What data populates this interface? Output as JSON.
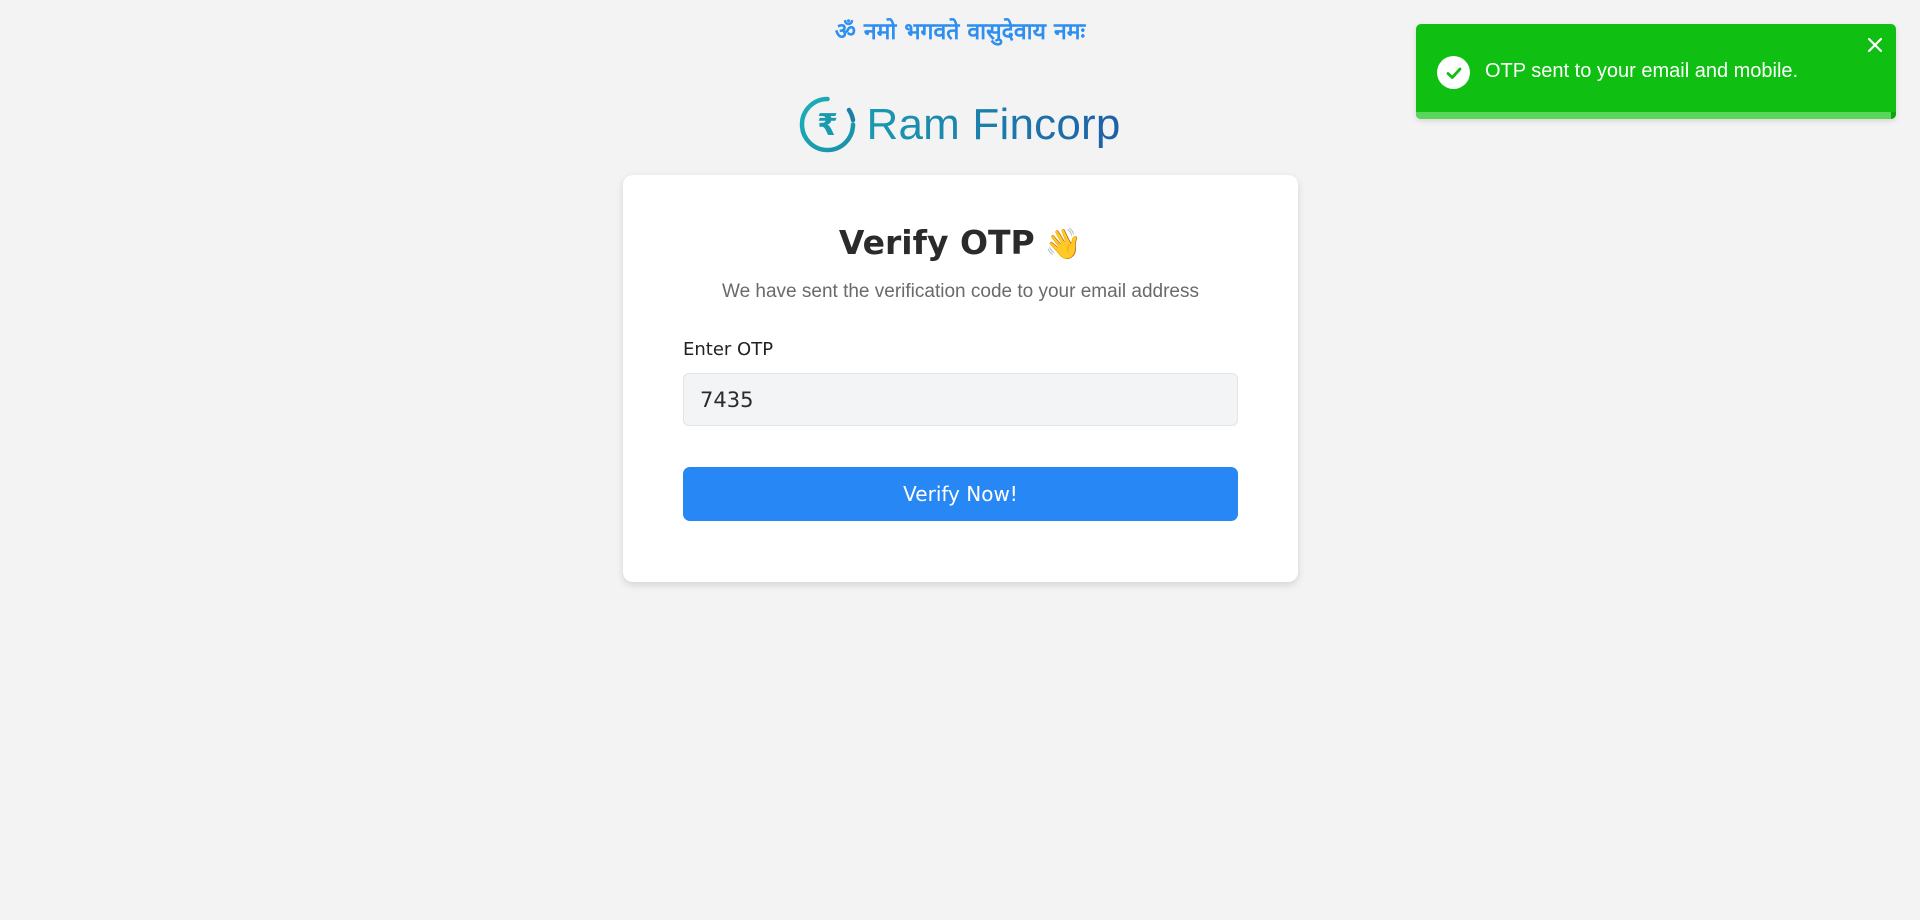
{
  "header": {
    "mantra": "ॐ नमो भगवते वासुदेवाय नमः"
  },
  "brand": {
    "name": "Ram Fincorp",
    "icon": "rupee-circle-icon",
    "colors": {
      "teal": "#1a9ab0",
      "blue": "#1e5fa6"
    }
  },
  "card": {
    "title": "Verify OTP",
    "title_emoji": "👋",
    "subtitle": "We have sent the verification code to your email address",
    "otp_label": "Enter OTP",
    "otp_value": "7435",
    "verify_button": "Verify Now!"
  },
  "toast": {
    "message": "OTP sent to your email and mobile.",
    "type": "success",
    "icon": "check-circle-icon",
    "close_icon": "close-icon",
    "progress_remaining": 0.99,
    "color": "#0fbf12"
  },
  "colors": {
    "primary_button": "#2787f5",
    "mantra": "#2f8ff0",
    "background": "#f3f3f3"
  }
}
